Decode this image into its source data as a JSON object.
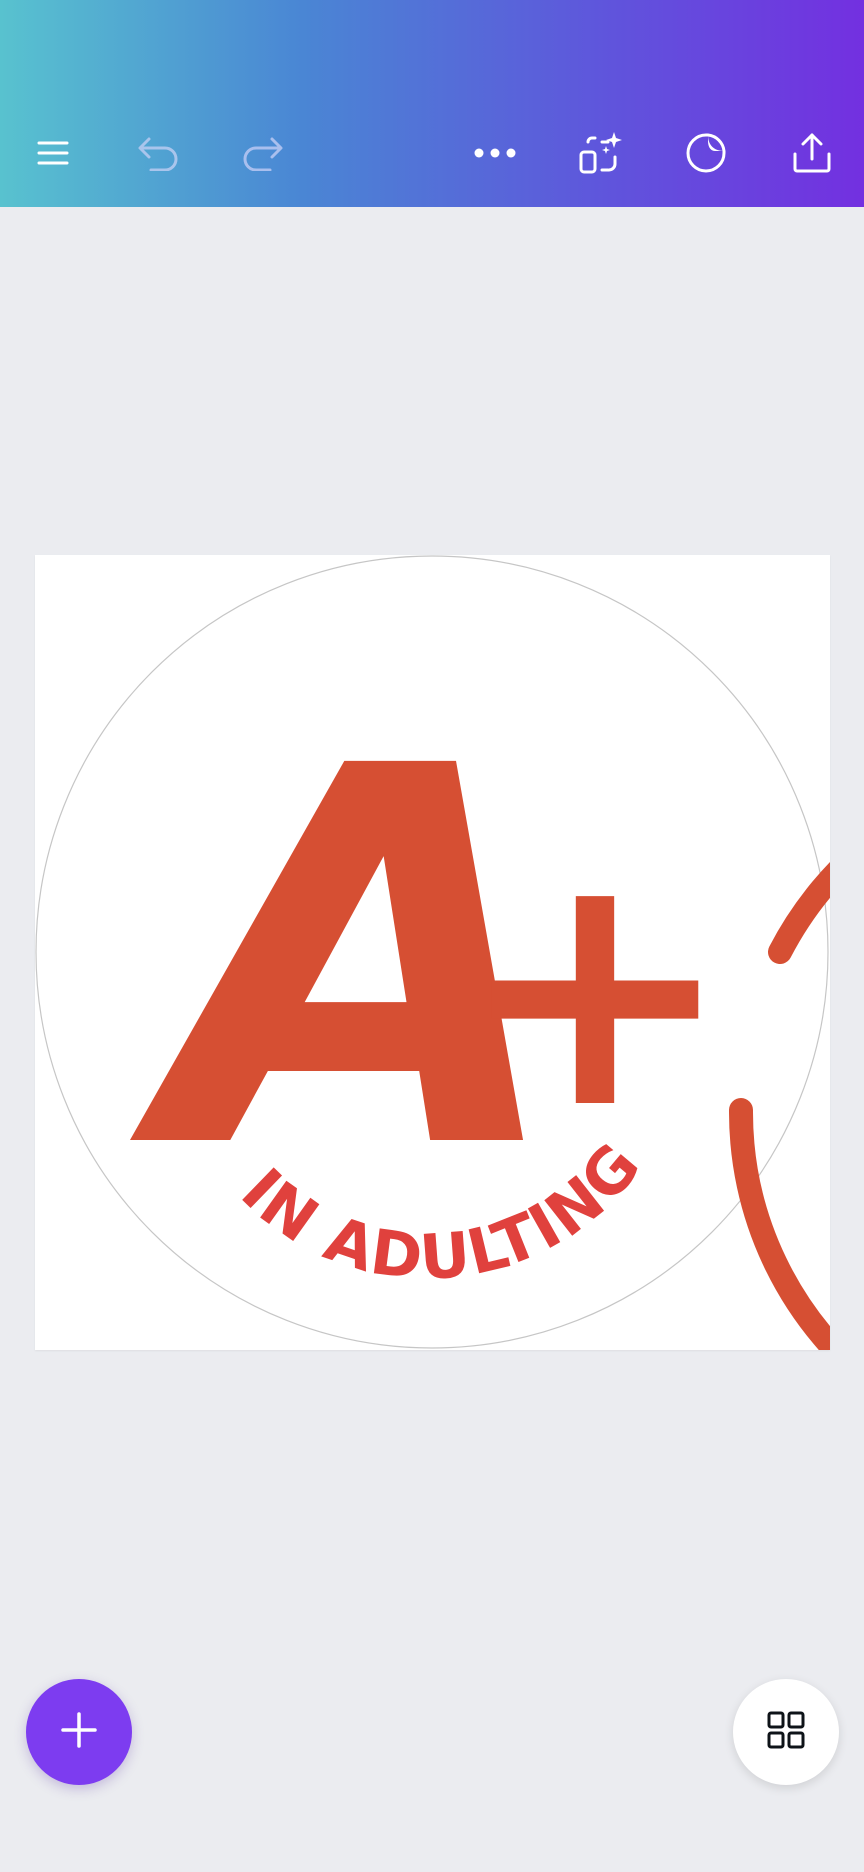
{
  "toolbar": {
    "gradient_colors": [
      "#58c2cf",
      "#4a86d4",
      "#5f55dc",
      "#7330e0"
    ],
    "buttons": [
      {
        "name": "menu",
        "icon": "menu-icon"
      },
      {
        "name": "undo",
        "icon": "undo-icon"
      },
      {
        "name": "redo",
        "icon": "redo-icon"
      },
      {
        "name": "more",
        "icon": "more-horizontal-icon"
      },
      {
        "name": "magic-resize",
        "icon": "resize-sparkle-icon"
      },
      {
        "name": "sticker",
        "icon": "sticker-icon"
      },
      {
        "name": "share",
        "icon": "share-upload-icon"
      }
    ]
  },
  "design": {
    "big_letter": "A",
    "plus_sign": "+",
    "curved_text": "IN ADULTING",
    "accent_color": "#d64f33",
    "text_color": "#e0413d",
    "background": "#ffffff"
  },
  "canvas": {
    "background": "#ebecf0"
  },
  "fab": {
    "add": {
      "icon": "plus-icon",
      "color": "#7d3cf0"
    },
    "pages": {
      "icon": "grid-icon"
    }
  }
}
